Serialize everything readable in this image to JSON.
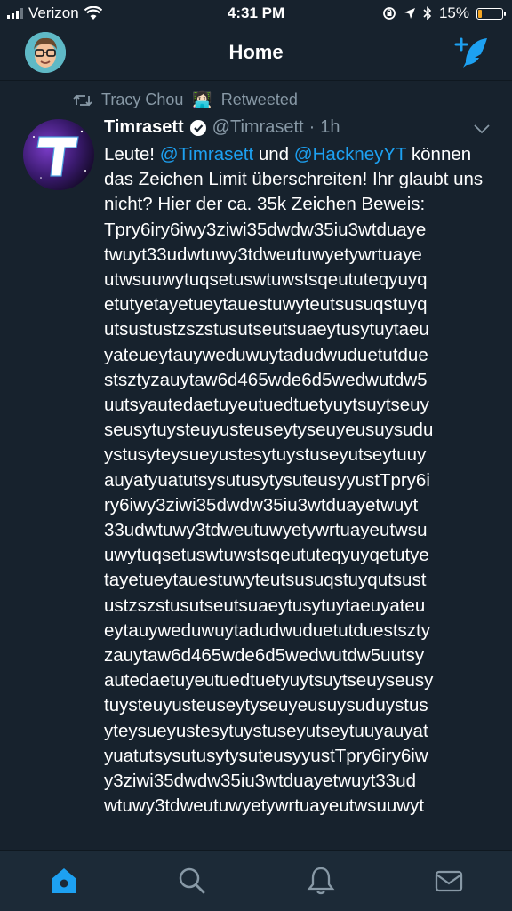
{
  "status_bar": {
    "carrier": "Verizon",
    "time": "4:31 PM",
    "battery_percent": "15%",
    "battery_level": 0.15
  },
  "nav": {
    "title": "Home"
  },
  "tweet": {
    "retweeted_by": "Tracy Chou",
    "retweeted_emoji": "👩🏻‍💻",
    "retweeted_label": "Retweeted",
    "display_name": "Timrasett",
    "handle": "@Timrasett",
    "separator": " · ",
    "time_ago": "1h",
    "body_part1": "Leute! ",
    "mention1": "@Timrasett",
    "body_part2": " und ",
    "mention2": "@HackneyYT",
    "body_part3": " können das Zeichen Limit überschreiten! Ihr glaubt uns nicht? Hier der ca. 35k Zeichen Beweis:",
    "lines": [
      "Tpry6iry6iwy3ziwi35dwdw35iu3wtduaye",
      "twuyt33udwtuwy3tdweutuwyetywrtuaye",
      "utwsuuwytuqsetuswtuwstsqeututeqyuyq",
      "etutyetayetueytauestuwyteutsusuqstuyq",
      "utsustustzszstusutseutsuaeytusytuytaeu",
      "yateueytauyweduwuytadudwuduetutdue",
      "stsztyzauytaw6d465wde6d5wedwutdw5",
      "uutsyautedaetuyeutuedtuetyuytsuytseuy",
      "seusytuysteuyusteuseytyseuyeusuysudu",
      "ystusyteysueyustesytuystuseyutseytuuy",
      "auyatyuatutsysutusytysuteusyyustTpry6i",
      "ry6iwy3ziwi35dwdw35iu3wtduayetwuyt",
      "33udwtuwy3tdweutuwyetywrtuayeutwsu",
      "uwytuqsetuswtuwstsqeututeqyuyqetutye",
      "tayetueytauestuwyteutsusuqstuyqutsust",
      "ustzszstusutseutsuaeytusytuytaeuyateu",
      "eytauyweduwuytadudwuduetutduestszty",
      "zauytaw6d465wde6d5wedwutdw5uutsy",
      "autedaetuyeutuedtuetyuytsuytseuyseusy",
      "tuysteuyusteuseytyseuyeusuysuduystus",
      "yteysueyustesytuystuseyutseytuuyauyat",
      "yuatutsysutusytysuteusyyustTpry6iry6iw",
      "y3ziwi35dwdw35iu3wtduayetwuyt33ud",
      "wtuwy3tdweutuwyetywrtuayeutwsuuwyt"
    ]
  },
  "tabs": [
    {
      "name": "home",
      "active": true
    },
    {
      "name": "search",
      "active": false
    },
    {
      "name": "notifications",
      "active": false
    },
    {
      "name": "messages",
      "active": false
    }
  ],
  "colors": {
    "background": "#17222d",
    "accent": "#1da1f2",
    "muted": "#8899a6",
    "tabbar": "#1c2a37"
  }
}
